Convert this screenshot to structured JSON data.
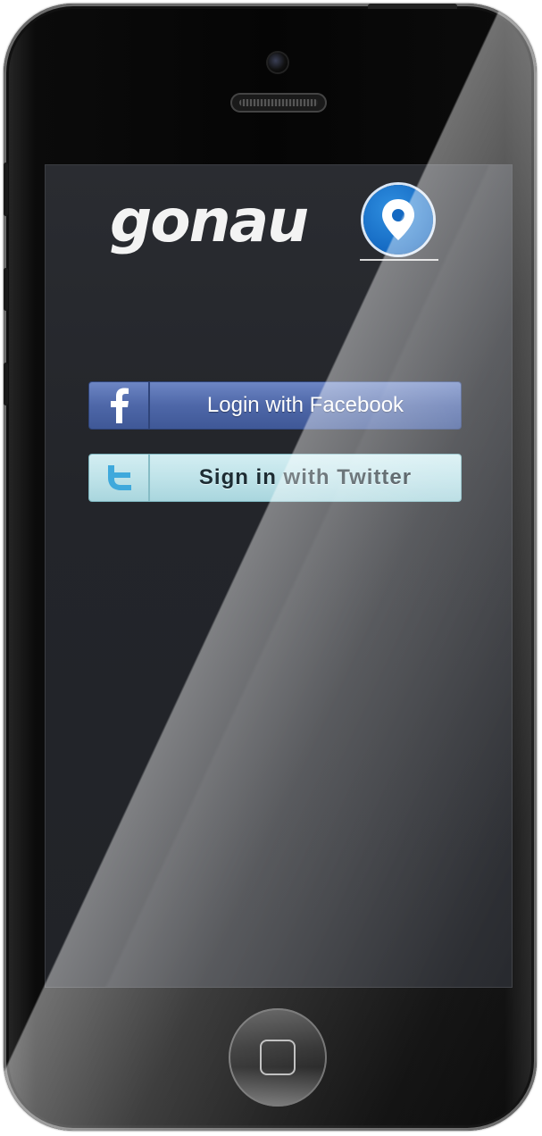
{
  "app": {
    "logo_text": "gonau"
  },
  "login": {
    "facebook_label": "Login with Facebook",
    "twitter_label": "Sign in with Twitter"
  },
  "icons": {
    "facebook": "facebook-f-icon",
    "twitter": "twitter-bird-icon",
    "logo_pin": "location-pin-icon",
    "home": "home-square-icon"
  },
  "colors": {
    "facebook_blue": "#4e67a8",
    "twitter_cyan": "#bfe3e9",
    "logo_pin_blue": "#1469c2",
    "screen_bg": "#23252a"
  }
}
